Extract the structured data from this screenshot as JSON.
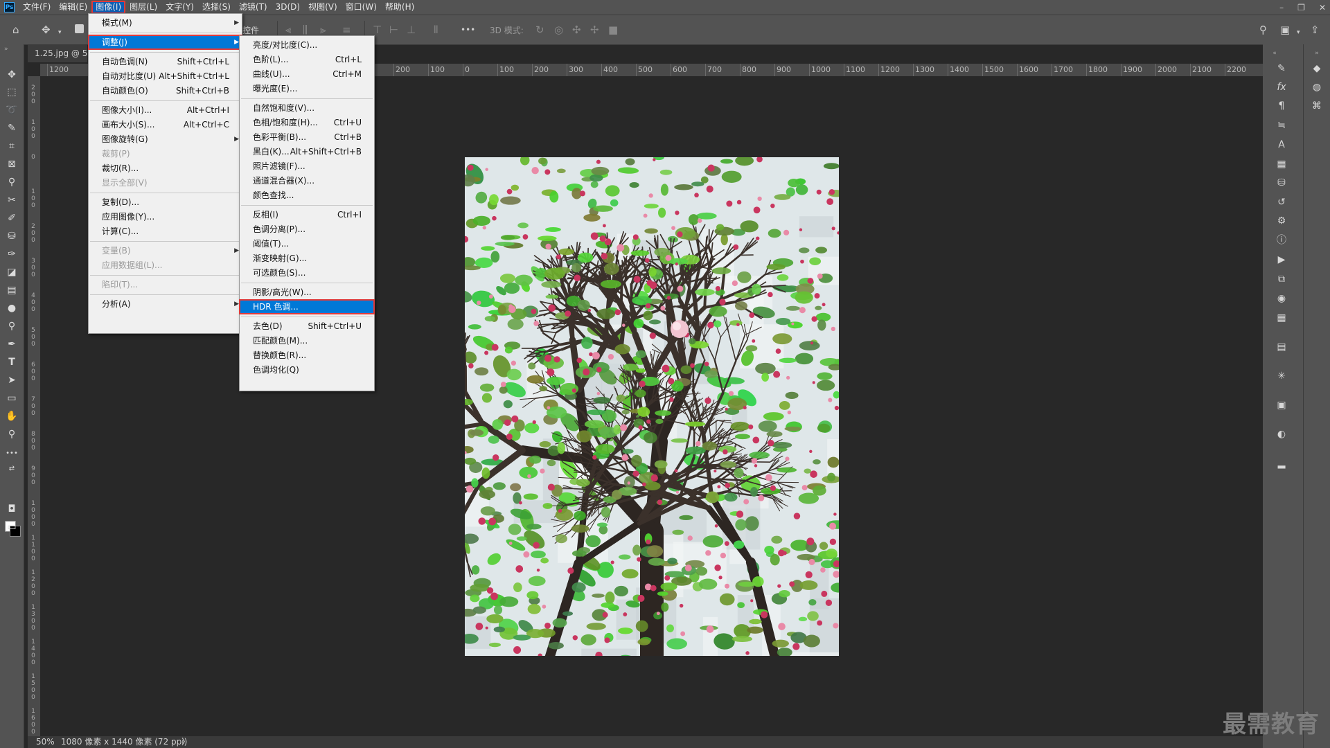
{
  "menubar": {
    "items": [
      "文件(F)",
      "编辑(E)",
      "图像(I)",
      "图层(L)",
      "文字(Y)",
      "选择(S)",
      "滤镜(T)",
      "3D(D)",
      "视图(V)",
      "窗口(W)",
      "帮助(H)"
    ],
    "active_index": 2,
    "logo": "Ps",
    "window_controls": [
      "–",
      "❐",
      "✕"
    ]
  },
  "optionsbar": {
    "checkbox_label_tail": "控件",
    "mode_3d_label": "3D 模式:",
    "more_label": "•••"
  },
  "document": {
    "tab_title": "1.25.jpg @ 5",
    "zoom": "50%",
    "info": "1080 像素 x 1440 像素 (72 ppi)",
    "info_arrow": "〉"
  },
  "ruler": {
    "h_labels": [
      "1200",
      "",
      "",
      "",
      "",
      "",
      "",
      "",
      "",
      "",
      "200",
      "100",
      "0",
      "100",
      "200",
      "300",
      "400",
      "500",
      "600",
      "700",
      "800",
      "900",
      "1000",
      "1100",
      "1200",
      "1300",
      "1400",
      "1500",
      "1600",
      "1700",
      "1800",
      "1900",
      "2000",
      "2100",
      "2200"
    ],
    "v_labels": [
      "200",
      "100",
      "0",
      "100",
      "200",
      "300",
      "400",
      "500",
      "600",
      "700",
      "800",
      "900",
      "1000",
      "1100",
      "1200",
      "1300",
      "1400",
      "1500",
      "1600"
    ]
  },
  "image_menu": {
    "items": [
      {
        "label": "模式(M)",
        "shortcut": "",
        "submenu": true,
        "disabled": false
      },
      {
        "sep": true
      },
      {
        "label": "调整(J)",
        "shortcut": "",
        "submenu": true,
        "disabled": false,
        "highlighted": true,
        "boxed": true
      },
      {
        "sep": true
      },
      {
        "label": "自动色调(N)",
        "shortcut": "Shift+Ctrl+L"
      },
      {
        "label": "自动对比度(U)",
        "shortcut": "Alt+Shift+Ctrl+L"
      },
      {
        "label": "自动颜色(O)",
        "shortcut": "Shift+Ctrl+B"
      },
      {
        "sep": true
      },
      {
        "label": "图像大小(I)...",
        "shortcut": "Alt+Ctrl+I"
      },
      {
        "label": "画布大小(S)...",
        "shortcut": "Alt+Ctrl+C"
      },
      {
        "label": "图像旋转(G)",
        "shortcut": "",
        "submenu": true
      },
      {
        "label": "裁剪(P)",
        "shortcut": "",
        "disabled": true
      },
      {
        "label": "裁切(R)...",
        "shortcut": ""
      },
      {
        "label": "显示全部(V)",
        "shortcut": "",
        "disabled": true
      },
      {
        "sep": true
      },
      {
        "label": "复制(D)...",
        "shortcut": ""
      },
      {
        "label": "应用图像(Y)...",
        "shortcut": ""
      },
      {
        "label": "计算(C)...",
        "shortcut": ""
      },
      {
        "sep": true
      },
      {
        "label": "变量(B)",
        "shortcut": "",
        "submenu": true,
        "disabled": true
      },
      {
        "label": "应用数据组(L)...",
        "shortcut": "",
        "disabled": true
      },
      {
        "sep": true
      },
      {
        "label": "陷印(T)...",
        "shortcut": "",
        "disabled": true
      },
      {
        "sep": true
      },
      {
        "label": "分析(A)",
        "shortcut": "",
        "submenu": true
      }
    ]
  },
  "adjust_menu": {
    "items": [
      {
        "label": "亮度/对比度(C)...",
        "shortcut": ""
      },
      {
        "label": "色阶(L)...",
        "shortcut": "Ctrl+L"
      },
      {
        "label": "曲线(U)...",
        "shortcut": "Ctrl+M"
      },
      {
        "label": "曝光度(E)...",
        "shortcut": ""
      },
      {
        "sep": true
      },
      {
        "label": "自然饱和度(V)...",
        "shortcut": ""
      },
      {
        "label": "色相/饱和度(H)...",
        "shortcut": "Ctrl+U"
      },
      {
        "label": "色彩平衡(B)...",
        "shortcut": "Ctrl+B"
      },
      {
        "label": "黑白(K)...",
        "shortcut": "Alt+Shift+Ctrl+B"
      },
      {
        "label": "照片滤镜(F)...",
        "shortcut": ""
      },
      {
        "label": "通道混合器(X)...",
        "shortcut": ""
      },
      {
        "label": "颜色查找...",
        "shortcut": ""
      },
      {
        "sep": true
      },
      {
        "label": "反相(I)",
        "shortcut": "Ctrl+I"
      },
      {
        "label": "色调分离(P)...",
        "shortcut": ""
      },
      {
        "label": "阈值(T)...",
        "shortcut": ""
      },
      {
        "label": "渐变映射(G)...",
        "shortcut": ""
      },
      {
        "label": "可选颜色(S)...",
        "shortcut": ""
      },
      {
        "sep": true
      },
      {
        "label": "阴影/高光(W)...",
        "shortcut": ""
      },
      {
        "label": "HDR 色调...",
        "shortcut": "",
        "highlighted": true,
        "boxed": true
      },
      {
        "sep": true
      },
      {
        "label": "去色(D)",
        "shortcut": "Shift+Ctrl+U"
      },
      {
        "label": "匹配颜色(M)...",
        "shortcut": ""
      },
      {
        "label": "替换颜色(R)...",
        "shortcut": ""
      },
      {
        "label": "色调均化(Q)",
        "shortcut": ""
      }
    ]
  },
  "tools": [
    {
      "icon": "move-icon",
      "glyph": "✥"
    },
    {
      "icon": "marquee-icon",
      "glyph": "⬚"
    },
    {
      "icon": "lasso-icon",
      "glyph": "➰"
    },
    {
      "icon": "quick-select-icon",
      "glyph": "✎"
    },
    {
      "icon": "crop-icon",
      "glyph": "⌗"
    },
    {
      "icon": "frame-icon",
      "glyph": "⊠"
    },
    {
      "icon": "eyedropper-icon",
      "glyph": "⚲"
    },
    {
      "icon": "healing-icon",
      "glyph": "✂"
    },
    {
      "icon": "brush-icon",
      "glyph": "✐"
    },
    {
      "icon": "stamp-icon",
      "glyph": "⛁"
    },
    {
      "icon": "history-brush-icon",
      "glyph": "✑"
    },
    {
      "icon": "eraser-icon",
      "glyph": "◪"
    },
    {
      "icon": "gradient-icon",
      "glyph": "▤"
    },
    {
      "icon": "blur-icon",
      "glyph": "●"
    },
    {
      "icon": "dodge-icon",
      "glyph": "⚲"
    },
    {
      "icon": "pen-icon",
      "glyph": "✒"
    },
    {
      "icon": "type-icon",
      "glyph": "T"
    },
    {
      "icon": "path-select-icon",
      "glyph": "➤"
    },
    {
      "icon": "rectangle-icon",
      "glyph": "▭"
    },
    {
      "icon": "hand-icon",
      "glyph": "✋"
    },
    {
      "icon": "zoom-icon",
      "glyph": "⚲"
    },
    {
      "icon": "more-tools-icon",
      "glyph": "•••"
    }
  ],
  "colors": {
    "foreground": "#ffffff",
    "background": "#000000",
    "highlight": "#0078d7",
    "annotation_box": "#e03a3a"
  },
  "watermark": "最需教育"
}
